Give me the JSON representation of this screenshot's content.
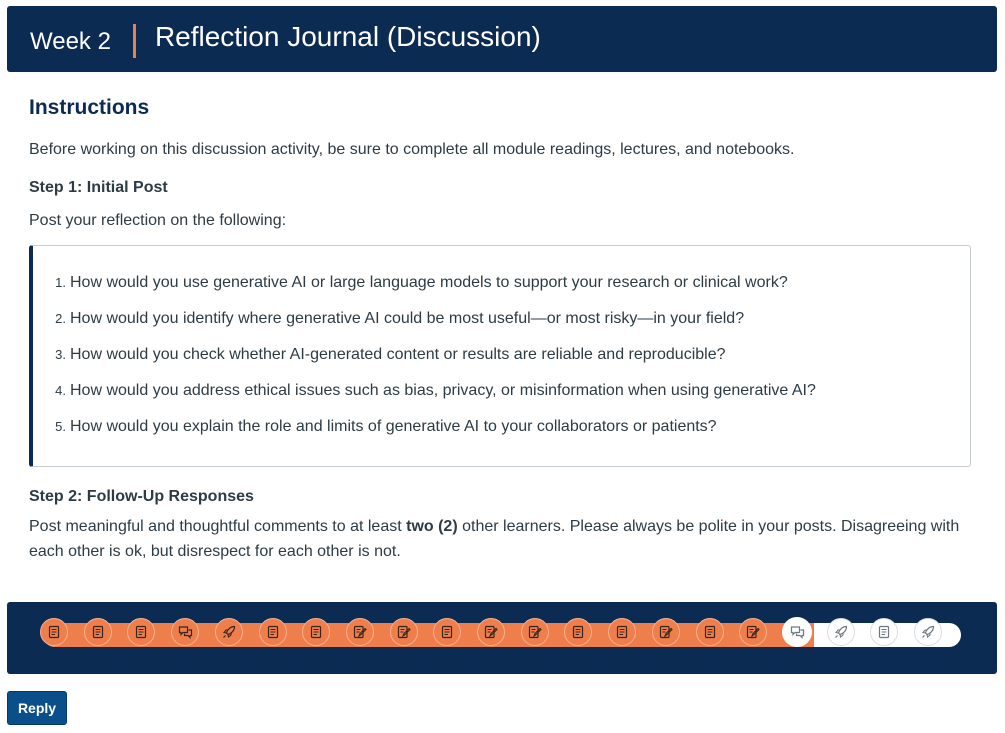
{
  "header": {
    "week": "Week 2",
    "title": "Reflection Journal (Discussion)",
    "a11y_icon": "text-size-icon"
  },
  "instructions": {
    "heading": "Instructions",
    "intro": "Before working on this discussion activity, be sure to complete all module readings, lectures, and notebooks.",
    "step1_heading": "Step 1: Initial Post",
    "step1_text": "Post your reflection on the following:",
    "questions": [
      {
        "num": "1.",
        "text": "How would you use generative AI or large language models to support your research or clinical work?"
      },
      {
        "num": "2.",
        "text": "How would you identify where generative AI could be most useful—or most risky—in your field?"
      },
      {
        "num": "3.",
        "text": "How would you check whether AI-generated content or results are reliable and reproducible?"
      },
      {
        "num": "4.",
        "text": "How would you address ethical issues such as bias, privacy, or misinformation when using generative AI?"
      },
      {
        "num": "5.",
        "text": "How would you explain the role and limits of generative AI to your collaborators or patients?"
      }
    ],
    "step2_heading": "Step 2: Follow-Up Responses",
    "step2_pre": "Post meaningful and thoughtful comments to at least ",
    "step2_bold": "two (2)",
    "step2_post": " other learners. Please always be polite in your posts. Disagreeing with each other is ok, but disrespect for each other is not."
  },
  "progress": {
    "completed_fraction": 0.84,
    "items": [
      {
        "icon": "page-icon",
        "state": "completed"
      },
      {
        "icon": "page-icon",
        "state": "completed"
      },
      {
        "icon": "page-icon",
        "state": "completed"
      },
      {
        "icon": "discussion-icon",
        "state": "completed"
      },
      {
        "icon": "rocket-icon",
        "state": "completed"
      },
      {
        "icon": "page-icon",
        "state": "completed"
      },
      {
        "icon": "page-icon",
        "state": "completed"
      },
      {
        "icon": "assignment-icon",
        "state": "completed"
      },
      {
        "icon": "assignment-icon",
        "state": "completed"
      },
      {
        "icon": "page-icon",
        "state": "completed"
      },
      {
        "icon": "assignment-icon",
        "state": "completed"
      },
      {
        "icon": "assignment-icon",
        "state": "completed"
      },
      {
        "icon": "page-icon",
        "state": "completed"
      },
      {
        "icon": "page-icon",
        "state": "completed"
      },
      {
        "icon": "assignment-icon",
        "state": "completed"
      },
      {
        "icon": "page-icon",
        "state": "completed"
      },
      {
        "icon": "assignment-icon",
        "state": "completed"
      },
      {
        "icon": "discussion-icon",
        "state": "current"
      },
      {
        "icon": "rocket-icon",
        "state": "future"
      },
      {
        "icon": "page-icon",
        "state": "future"
      },
      {
        "icon": "rocket-icon",
        "state": "future"
      }
    ]
  },
  "reply": {
    "label": "Reply"
  },
  "colors": {
    "navy": "#0b2b52",
    "accent_orange": "#ee7f4d",
    "text": "#2d3b45",
    "button_blue": "#0b4f8a"
  }
}
